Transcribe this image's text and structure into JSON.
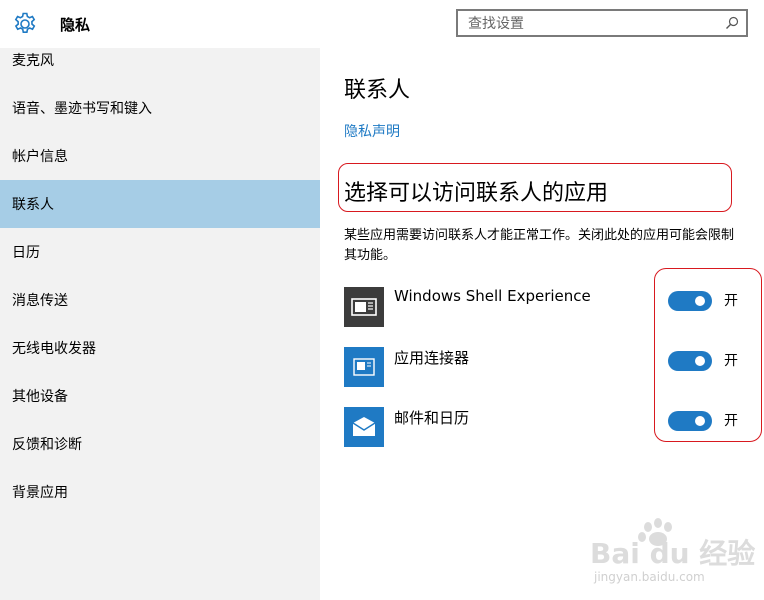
{
  "header": {
    "title": "隐私",
    "search_placeholder": "查找设置"
  },
  "sidebar": {
    "items": [
      {
        "label": "麦克风",
        "active": false
      },
      {
        "label": "语音、墨迹书写和键入",
        "active": false
      },
      {
        "label": "帐户信息",
        "active": false
      },
      {
        "label": "联系人",
        "active": true
      },
      {
        "label": "日历",
        "active": false
      },
      {
        "label": "消息传送",
        "active": false
      },
      {
        "label": "无线电收发器",
        "active": false
      },
      {
        "label": "其他设备",
        "active": false
      },
      {
        "label": "反馈和诊断",
        "active": false
      },
      {
        "label": "背景应用",
        "active": false
      }
    ]
  },
  "main": {
    "page_title": "联系人",
    "privacy_link": "隐私声明",
    "section_title": "选择可以访问联系人的应用",
    "description": "某些应用需要访问联系人才能正常工作。关闭此处的应用可能会限制其功能。",
    "apps": [
      {
        "name": "Windows Shell Experience",
        "icon": "shell-experience-icon",
        "toggle": "开",
        "on": true
      },
      {
        "name": "应用连接器",
        "icon": "app-connector-icon",
        "toggle": "开",
        "on": true
      },
      {
        "name": "邮件和日历",
        "icon": "mail-calendar-icon",
        "toggle": "开",
        "on": true
      }
    ]
  },
  "watermark": {
    "brand": "Bai du 经验",
    "url": "jingyan.baidu.com"
  },
  "colors": {
    "accent": "#1f7ac4",
    "active_item": "#a6cde6",
    "sidebar_bg": "#f2f2f2",
    "annotation_red": "#d8191f"
  }
}
